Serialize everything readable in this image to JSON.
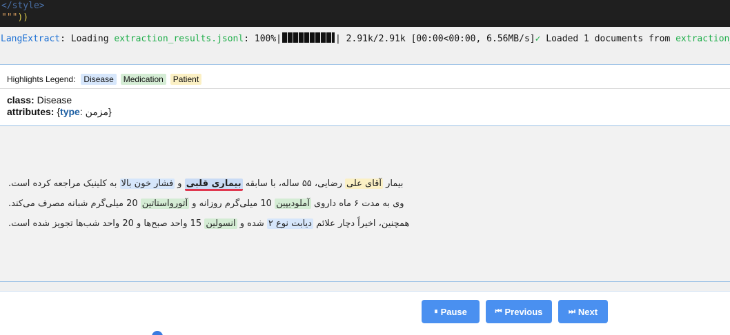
{
  "code": {
    "line1": "</style>",
    "line2_quotes": "\"\"\"",
    "line2_parens": "))"
  },
  "progress": {
    "app": "LangExtract",
    "sep": ": Loading ",
    "file": "extraction_results.jsonl",
    "percent": ": 100%|",
    "stats": "| 2.91k/2.91k [00:00<00:00, 6.56MB/s]",
    "check": "✓",
    "loaded": " Loaded 1 documents from ",
    "file2": "extraction_r",
    "fraction": 1.0
  },
  "legend": {
    "label": "Highlights Legend:",
    "items": [
      "Disease",
      "Medication",
      "Patient"
    ]
  },
  "info": {
    "class_label": "class:",
    "class_value": " Disease",
    "attributes_label": "attributes:",
    "open": " {",
    "type_key": "type",
    "type_value": ": مزمن",
    "close": "}"
  },
  "document": {
    "line1": {
      "s1": "بیمار ",
      "patient": "آقای علی",
      "s2": " رضایی، ۵۵ ساله، با سابقه ",
      "disease_active": "بیماری قلبی",
      "s3": " و ",
      "disease2": "فشار خون بالا",
      "s4": " به کلینیک مراجعه کرده است."
    },
    "line2": {
      "s1": "وی به مدت ۶ ماه داروی ",
      "med1": "آملودیپین",
      "s2": " 10 میلی‌گرم روزانه و ",
      "med2": "آتورواستاتین",
      "s3": " 20 میلی‌گرم شبانه مصرف می‌کند."
    },
    "line3": {
      "s1": "همچنین، اخیراً دچار علائم ",
      "disease3": "دیابت نوع ۲",
      "s2": " شده و ",
      "med3": "انسولین",
      "s3": " 15 واحد صبح‌ها و 20 واحد شب‌ها تجویز شده است."
    }
  },
  "controls": {
    "pause_icon": "⏸",
    "pause": "Pause",
    "prev_icon": "⏮",
    "prev": "Previous",
    "next_icon": "⏭",
    "next": "Next"
  }
}
